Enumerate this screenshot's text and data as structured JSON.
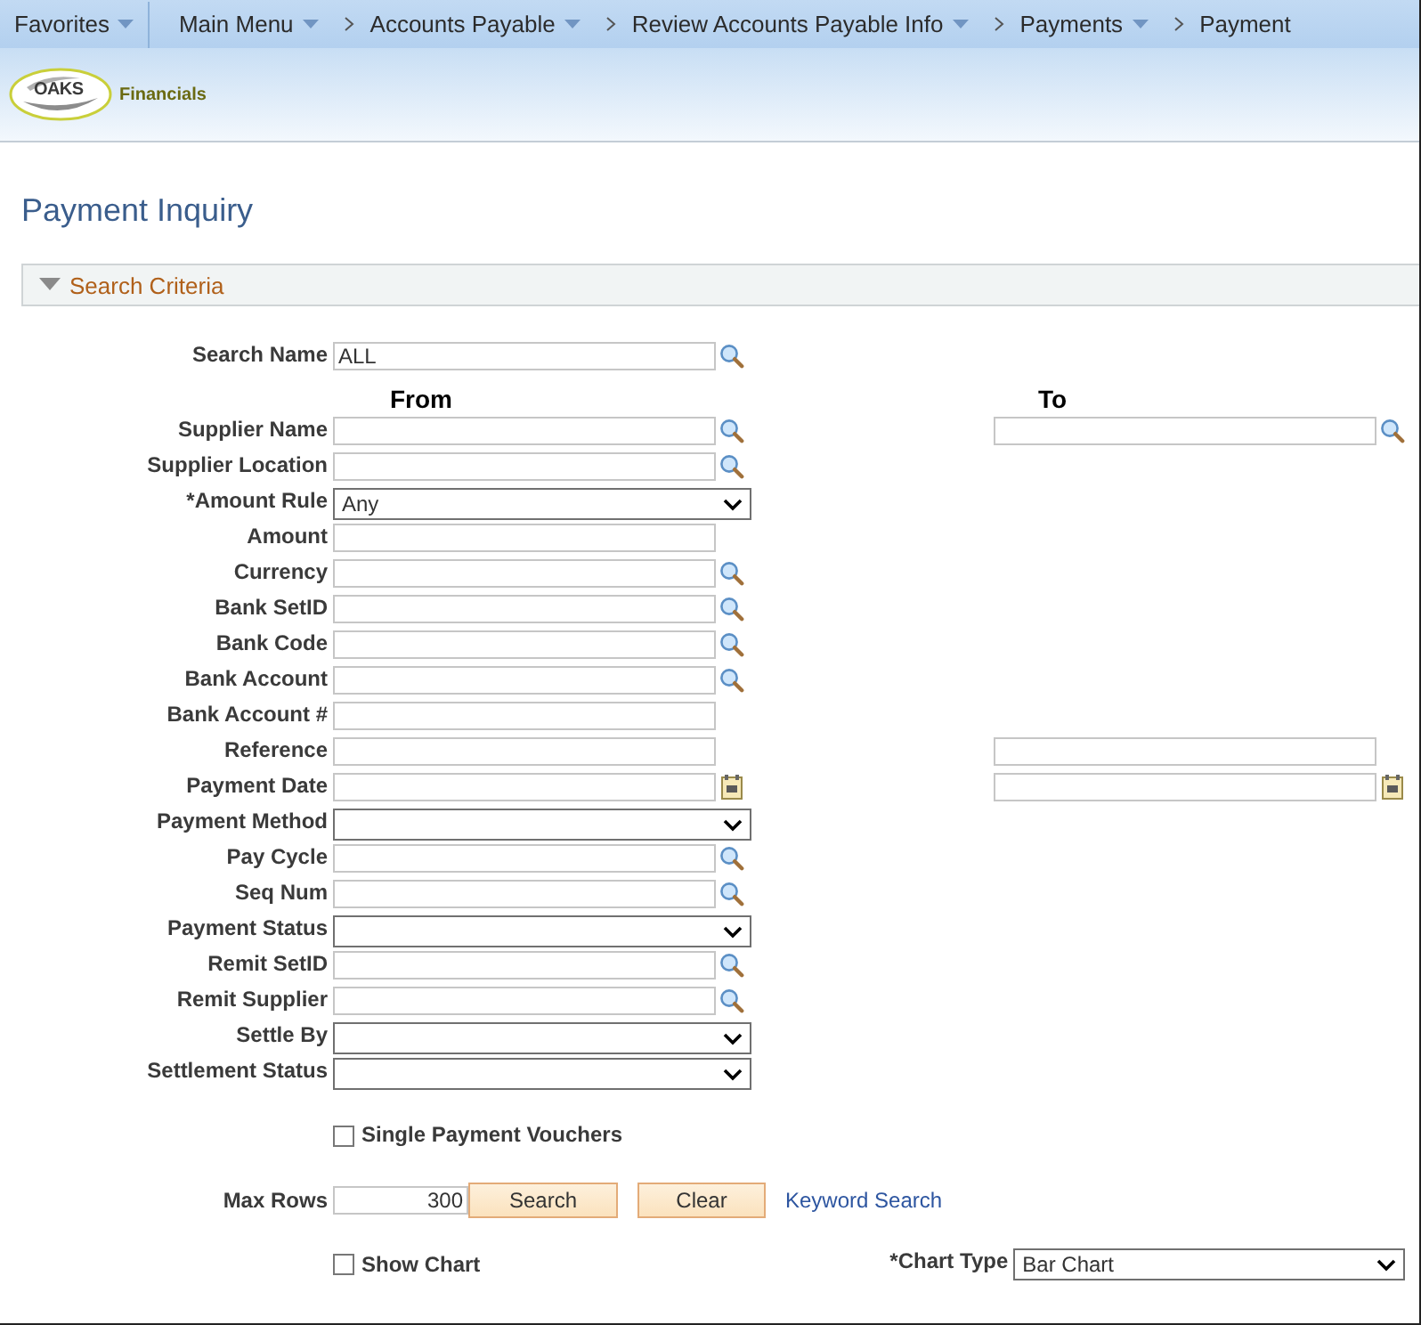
{
  "breadcrumb": [
    {
      "label": "Favorites",
      "menu": true
    },
    {
      "label": "Main Menu",
      "menu": true
    },
    {
      "label": "Accounts Payable",
      "menu": true
    },
    {
      "label": "Review Accounts Payable Info",
      "menu": true
    },
    {
      "label": "Payments",
      "menu": true
    },
    {
      "label": "Payment",
      "menu": false
    }
  ],
  "logo": {
    "mark": "OAKS",
    "caption": "Financials"
  },
  "page_title": "Payment Inquiry",
  "section": {
    "title": "Search Criteria",
    "expanded": true
  },
  "column_headings": [
    "From",
    "To"
  ],
  "fields": [
    {
      "label": "Search Name",
      "kind": "lookup",
      "value": "ALL"
    },
    {
      "label": "Supplier Name",
      "kind": "lookup",
      "to": {
        "kind": "lookup"
      }
    },
    {
      "label": "Supplier Location",
      "kind": "lookup"
    },
    {
      "label": "*Amount Rule",
      "kind": "select",
      "value": "Any"
    },
    {
      "label": "Amount",
      "kind": "text"
    },
    {
      "label": "Currency",
      "kind": "lookup"
    },
    {
      "label": "Bank SetID",
      "kind": "lookup"
    },
    {
      "label": "Bank Code",
      "kind": "lookup"
    },
    {
      "label": "Bank Account",
      "kind": "lookup"
    },
    {
      "label": "Bank Account #",
      "kind": "text"
    },
    {
      "label": "Reference",
      "kind": "text",
      "to": {
        "kind": "text"
      }
    },
    {
      "label": "Payment Date",
      "kind": "date",
      "to": {
        "kind": "date"
      }
    },
    {
      "label": "Payment Method",
      "kind": "select"
    },
    {
      "label": "Pay Cycle",
      "kind": "lookup"
    },
    {
      "label": "Seq Num",
      "kind": "lookup"
    },
    {
      "label": "Payment Status",
      "kind": "select"
    },
    {
      "label": "Remit SetID",
      "kind": "lookup"
    },
    {
      "label": "Remit Supplier",
      "kind": "lookup"
    },
    {
      "label": "Settle By",
      "kind": "select"
    },
    {
      "label": "Settlement Status",
      "kind": "select"
    }
  ],
  "single_payment_vouchers": {
    "label": "Single Payment Vouchers",
    "checked": false
  },
  "max_rows": {
    "label": "Max Rows",
    "value": "300"
  },
  "buttons": [
    "Search",
    "Clear"
  ],
  "keyword_search": "Keyword Search",
  "show_chart": {
    "label": "Show Chart",
    "checked": false
  },
  "chart_type": {
    "label": "*Chart Type",
    "value": "Bar Chart"
  }
}
